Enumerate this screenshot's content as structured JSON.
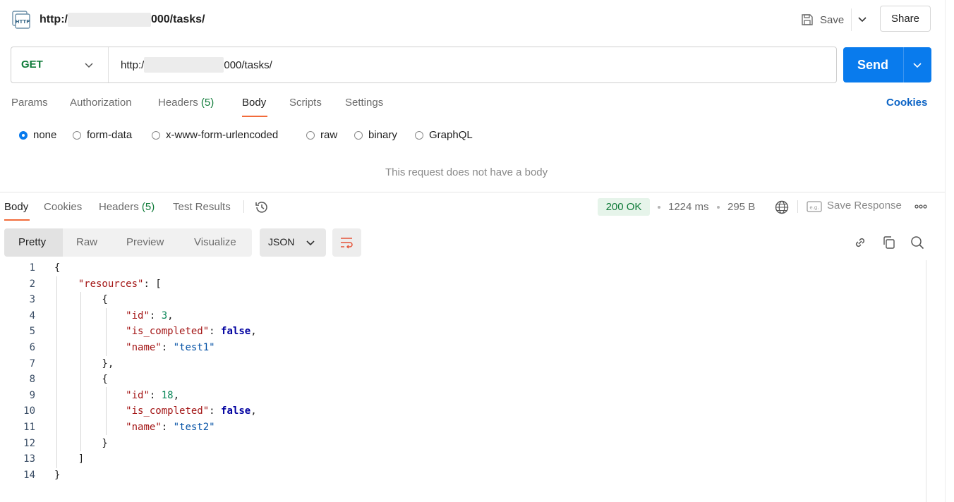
{
  "header": {
    "title_prefix": "http:/",
    "title_suffix": "000/tasks/",
    "save_label": "Save",
    "share_label": "Share"
  },
  "request": {
    "method": "GET",
    "url_prefix": "http:/",
    "url_suffix": "000/tasks/",
    "send_label": "Send",
    "tabs": [
      {
        "label": "Params"
      },
      {
        "label": "Authorization"
      },
      {
        "label": "Headers",
        "count": "(5)"
      },
      {
        "label": "Body"
      },
      {
        "label": "Scripts"
      },
      {
        "label": "Settings"
      }
    ],
    "active_tab": "Body",
    "cookies_label": "Cookies",
    "body_types": [
      "none",
      "form-data",
      "x-www-form-urlencoded",
      "raw",
      "binary",
      "GraphQL"
    ],
    "selected_body_type": "none",
    "no_body_message": "This request does not have a body"
  },
  "response": {
    "tabs": [
      {
        "label": "Body"
      },
      {
        "label": "Cookies"
      },
      {
        "label": "Headers",
        "count": "(5)"
      },
      {
        "label": "Test Results"
      }
    ],
    "active_tab": "Body",
    "status": "200 OK",
    "time": "1224 ms",
    "size": "295 B",
    "save_response_label": "Save Response",
    "view_modes": [
      "Pretty",
      "Raw",
      "Preview",
      "Visualize"
    ],
    "active_view": "Pretty",
    "format": "JSON",
    "lines": [
      {
        "num": "1"
      },
      {
        "num": "2"
      },
      {
        "num": "3"
      },
      {
        "num": "4"
      },
      {
        "num": "5"
      },
      {
        "num": "6"
      },
      {
        "num": "7"
      },
      {
        "num": "8"
      },
      {
        "num": "9"
      },
      {
        "num": "10"
      },
      {
        "num": "11"
      },
      {
        "num": "12"
      },
      {
        "num": "13"
      },
      {
        "num": "14"
      }
    ],
    "json": {
      "key_resources": "\"resources\"",
      "key_id": "\"id\"",
      "key_is_completed": "\"is_completed\"",
      "key_name": "\"name\"",
      "item1_id": "3",
      "item1_completed": "false",
      "item1_name": "\"test1\"",
      "item2_id": "18",
      "item2_completed": "false",
      "item2_name": "\"test2\""
    }
  },
  "colors": {
    "accent": "#097bed",
    "tab_underline": "#f26b3a",
    "method_green": "#0e7a38",
    "status_bg": "#e6f4ea",
    "link_blue": "#0b63c5"
  },
  "icons": [
    "http-icon",
    "save-icon",
    "chevron-down-icon",
    "history-icon",
    "globe-icon",
    "save-response-icon",
    "more-icon",
    "wrap-lines-icon",
    "link-icon",
    "copy-icon",
    "search-icon"
  ]
}
